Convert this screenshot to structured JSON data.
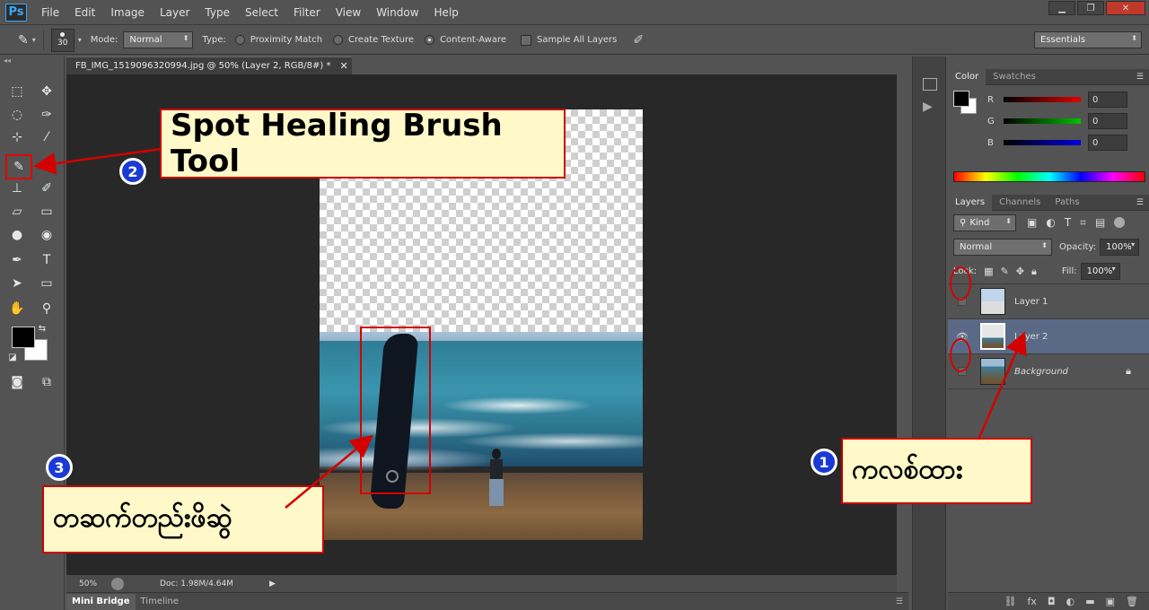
{
  "app": {
    "logo": "Ps"
  },
  "menu": [
    "File",
    "Edit",
    "Image",
    "Layer",
    "Type",
    "Select",
    "Filter",
    "View",
    "Window",
    "Help"
  ],
  "options_bar": {
    "brush_size": "30",
    "mode_label": "Mode:",
    "mode_value": "Normal",
    "type_label": "Type:",
    "proximity": "Proximity Match",
    "create_texture": "Create Texture",
    "content_aware": "Content-Aware",
    "sample_all": "Sample All Layers",
    "workspace": "Essentials"
  },
  "document": {
    "tab_title": "FB_IMG_1519096320994.jpg @ 50% (Layer 2, RGB/8#) *",
    "zoom": "50%",
    "doc_info": "Doc: 1.98M/4.64M"
  },
  "bottom_tabs": [
    "Mini Bridge",
    "Timeline"
  ],
  "color_panel": {
    "tabs": [
      "Color",
      "Swatches"
    ],
    "channels": [
      {
        "label": "R",
        "value": "0",
        "color": "#e00000"
      },
      {
        "label": "G",
        "value": "0",
        "color": "#00c000"
      },
      {
        "label": "B",
        "value": "0",
        "color": "#0000e0"
      }
    ]
  },
  "layers_panel": {
    "tabs": [
      "Layers",
      "Channels",
      "Paths"
    ],
    "kind": "Kind",
    "blend": "Normal",
    "opacity_label": "Opacity:",
    "opacity": "100%",
    "lock_label": "Lock:",
    "fill_label": "Fill:",
    "fill": "100%",
    "layers": [
      {
        "name": "Layer 1",
        "visible": false
      },
      {
        "name": "Layer 2",
        "visible": true
      },
      {
        "name": "Background",
        "visible": false
      }
    ]
  },
  "annotations": {
    "tool_callout": "Spot Healing Brush Tool",
    "step1_text": "ကလစ်ထား",
    "step3_text": "တဆက်တည်းဖိဆွဲ",
    "badges": [
      "1",
      "2",
      "3"
    ]
  },
  "colors": {
    "annotation_red": "#d40000",
    "callout_bg": "#fff8c8",
    "badge_blue": "#1a3ad6",
    "active_layer": "#5a6a86"
  }
}
